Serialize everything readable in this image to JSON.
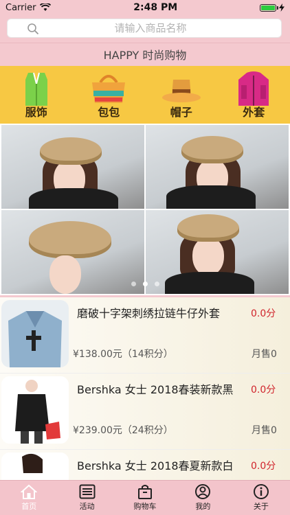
{
  "status": {
    "carrier": "Carrier",
    "time": "2:48 PM"
  },
  "search": {
    "placeholder": "请输入商品名称"
  },
  "title": "HAPPY 时尚购物",
  "categories": [
    {
      "label": "服饰",
      "icon": "vest-icon"
    },
    {
      "label": "包包",
      "icon": "bag-icon"
    },
    {
      "label": "帽子",
      "icon": "hat-icon"
    },
    {
      "label": "外套",
      "icon": "jacket-icon"
    }
  ],
  "banner": {
    "pages": 3,
    "active_page": 2
  },
  "products": [
    {
      "name": "磨破十字架刺绣拉链牛仔外套",
      "price": "0.0分",
      "sub": "¥138.00元（14积分）",
      "sold": "月售0"
    },
    {
      "name": "Bershka 女士 2018春装新款黑",
      "price": "0.0分",
      "sub": "¥239.00元（24积分）",
      "sold": "月售0"
    },
    {
      "name": "Bershka 女士 2018春夏新款白",
      "price": "0.0分",
      "sub": "",
      "sold": ""
    }
  ],
  "tabs": [
    {
      "label": "首页",
      "icon": "home-icon"
    },
    {
      "label": "活动",
      "icon": "list-icon"
    },
    {
      "label": "购物车",
      "icon": "cart-icon"
    },
    {
      "label": "我的",
      "icon": "user-icon"
    },
    {
      "label": "关于",
      "icon": "info-icon"
    }
  ],
  "colors": {
    "accent": "#f7c843",
    "price": "#d0232b",
    "tabbar": "#f3c4cb"
  }
}
